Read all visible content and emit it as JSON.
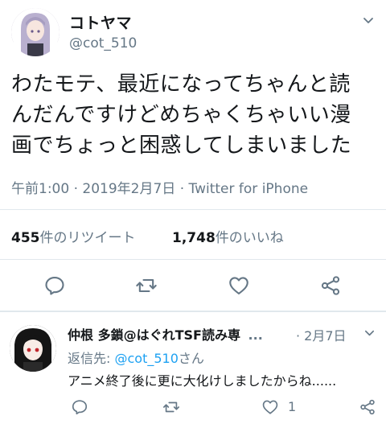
{
  "tweet": {
    "display_name": "コトヤマ",
    "handle": "@cot_510",
    "text_lines": [
      "わたモテ、最近になってちゃんと読",
      "んだんですけどめちゃくちゃいい漫",
      "画でちょっと困惑してしまいました"
    ],
    "time": "午前1:00",
    "date": "2019年2月7日",
    "client": "Twitter for iPhone",
    "retweets_count": "455",
    "retweets_label": "件のリツイート",
    "likes_count": "1,748",
    "likes_label": "件のいいね"
  },
  "actions": {
    "icons": [
      "reply-icon",
      "retweet-icon",
      "like-icon",
      "share-icon"
    ]
  },
  "reply": {
    "display_name": "仲根 多鎖@はぐれTSF読み専",
    "ellipsis": "...",
    "date": "2月7日",
    "reply_to_prefix": "返信先: ",
    "reply_to_mention": "@cot_510",
    "reply_to_suffix": "さん",
    "text": "アニメ終了後に更に大化けしましたからね......",
    "like_count": "1"
  },
  "colors": {
    "text": "#14171a",
    "secondary": "#657786",
    "link": "#1da1f2",
    "divider": "#e1e8ed"
  }
}
